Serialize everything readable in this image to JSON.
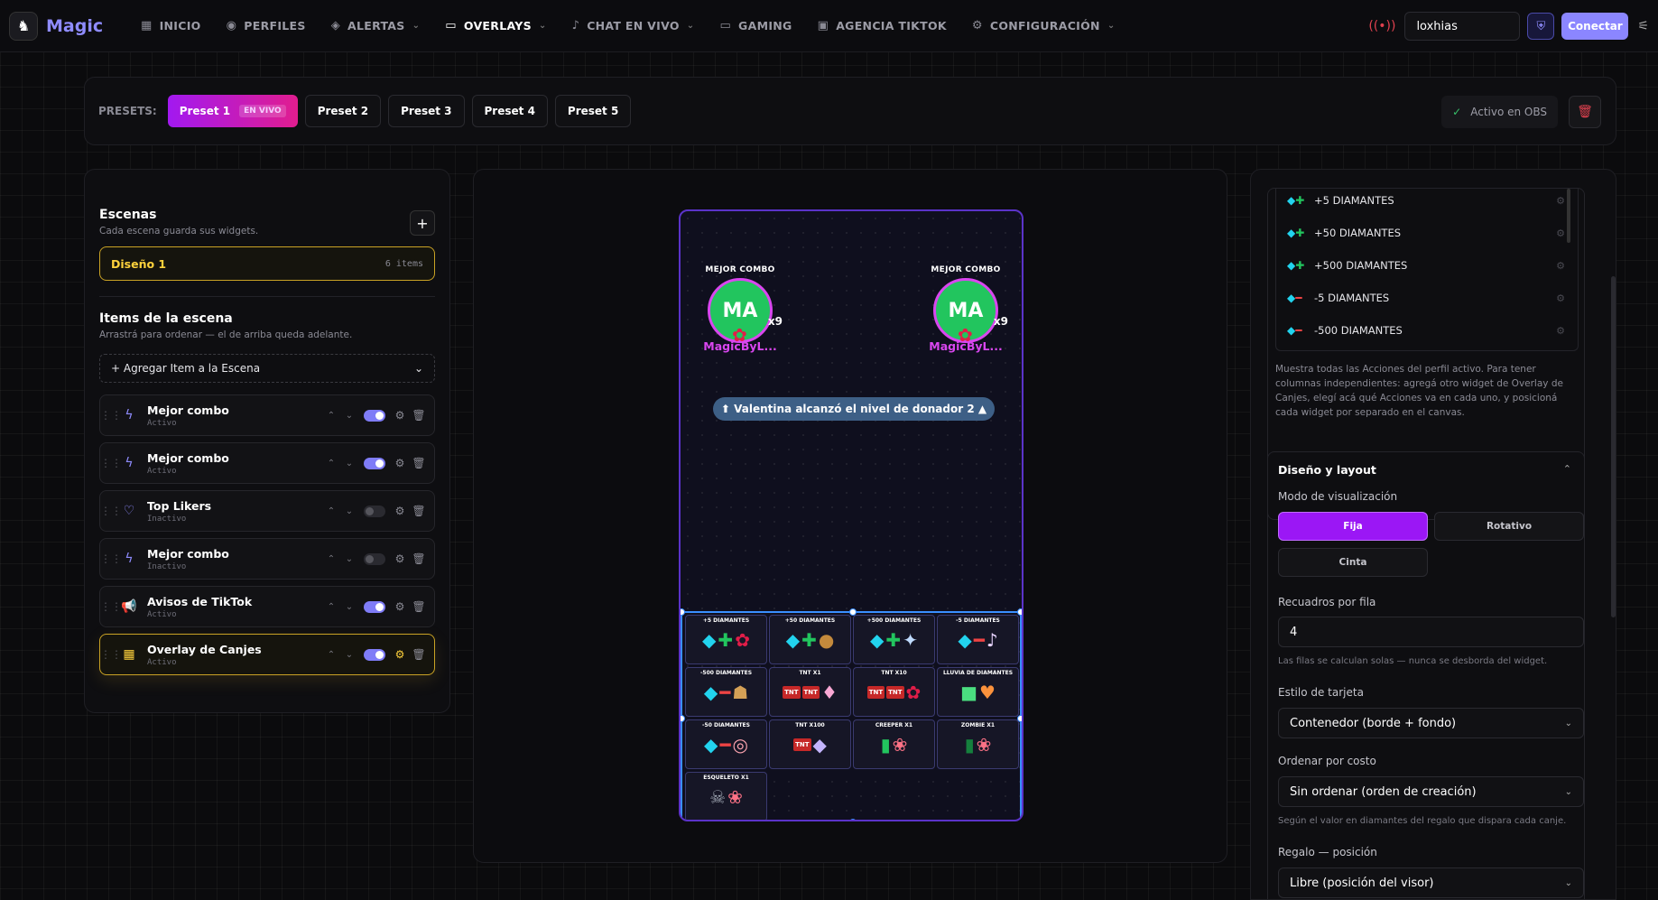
{
  "app": {
    "name": "Magic"
  },
  "nav": [
    {
      "label": "INICIO",
      "icon": "grid-icon",
      "dropdown": false,
      "active": false
    },
    {
      "label": "PERFILES",
      "icon": "user-circle-icon",
      "dropdown": false,
      "active": false
    },
    {
      "label": "ALERTAS",
      "icon": "layers-icon",
      "dropdown": true,
      "active": false
    },
    {
      "label": "OVERLAYS",
      "icon": "tv-icon",
      "dropdown": true,
      "active": true
    },
    {
      "label": "CHAT EN VIVO",
      "icon": "mic-icon",
      "dropdown": true,
      "active": false
    },
    {
      "label": "GAMING",
      "icon": "gamepad-icon",
      "dropdown": false,
      "active": false
    },
    {
      "label": "AGENCIA TIKTOK",
      "icon": "briefcase-icon",
      "dropdown": false,
      "active": false
    },
    {
      "label": "CONFIGURACIÓN",
      "icon": "gear-icon",
      "dropdown": true,
      "active": false
    }
  ],
  "header": {
    "username": "loxhias",
    "connect_label": "Conectar"
  },
  "presets": {
    "label": "PRESETS:",
    "items": [
      "Preset 1",
      "Preset 2",
      "Preset 3",
      "Preset 4",
      "Preset 5"
    ],
    "live_badge": "EN VIVO",
    "obs_status": "Activo en OBS"
  },
  "scenes": {
    "title": "Escenas",
    "subtitle": "Cada escena guarda sus widgets.",
    "current": {
      "name": "Diseño 1",
      "count": "6 items"
    }
  },
  "scene_items": {
    "title": "Items de la escena",
    "subtitle": "Arrastrá para ordenar — el de arriba queda adelante.",
    "add_label": "+ Agregar Item a la Escena",
    "items": [
      {
        "name": "Mejor combo",
        "state": "Activo",
        "icon": "bolt-icon",
        "on": true
      },
      {
        "name": "Mejor combo",
        "state": "Activo",
        "icon": "bolt-icon",
        "on": true
      },
      {
        "name": "Top Likers",
        "state": "Inactivo",
        "icon": "heart-icon",
        "on": false
      },
      {
        "name": "Mejor combo",
        "state": "Inactivo",
        "icon": "bolt-icon",
        "on": false
      },
      {
        "name": "Avisos de TikTok",
        "state": "Activo",
        "icon": "megaphone-icon",
        "on": true
      },
      {
        "name": "Overlay de Canjes",
        "state": "Activo",
        "icon": "apps-icon",
        "on": true
      }
    ]
  },
  "canvas": {
    "combos": [
      {
        "title": "MEJOR COMBO",
        "initials": "MA",
        "multiplier": "x9",
        "user": "MagicByL..."
      },
      {
        "title": "MEJOR COMBO",
        "initials": "MA",
        "multiplier": "x9",
        "user": "MagicByL..."
      }
    ],
    "notice": "⬆ Valentina alcanzó el nivel de donador 2 ▲",
    "tiles": [
      "+5 DIAMANTES",
      "+50 DIAMANTES",
      "+500 DIAMANTES",
      "-5 DIAMANTES",
      "-500 DIAMANTES",
      "TNT X1",
      "TNT X10",
      "LLUVIA DE DIAMANTES",
      "-50 DIAMANTES",
      "TNT X100",
      "CREEPER X1",
      "ZOMBIE X1",
      "ESQUELETO X1"
    ]
  },
  "actions": {
    "items": [
      "+5 DIAMANTES",
      "+50 DIAMANTES",
      "+500 DIAMANTES",
      "-5 DIAMANTES",
      "-500 DIAMANTES"
    ],
    "help": "Muestra todas las Acciones del perfil activo. Para tener columnas independientes: agregá otro widget de Overlay de Canjes, elegí acá qué Acciones va en cada uno, y posicioná cada widget por separado en el canvas."
  },
  "layout": {
    "title": "Diseño y layout",
    "view_mode_label": "Modo de visualización",
    "modes": [
      "Fija",
      "Rotativo",
      "Cinta"
    ],
    "boxes_label": "Recuadros por fila",
    "boxes_value": "4",
    "boxes_hint": "Las filas se calculan solas — nunca se desborda del widget.",
    "card_style_label": "Estilo de tarjeta",
    "card_style_value": "Contenedor (borde + fondo)",
    "sort_label": "Ordenar por costo",
    "sort_value": "Sin ordenar (orden de creación)",
    "sort_hint": "Según el valor en diamantes del regalo que dispara cada canje.",
    "gift_pos_label": "Regalo — posición",
    "gift_pos_value": "Libre (posición del visor)"
  }
}
